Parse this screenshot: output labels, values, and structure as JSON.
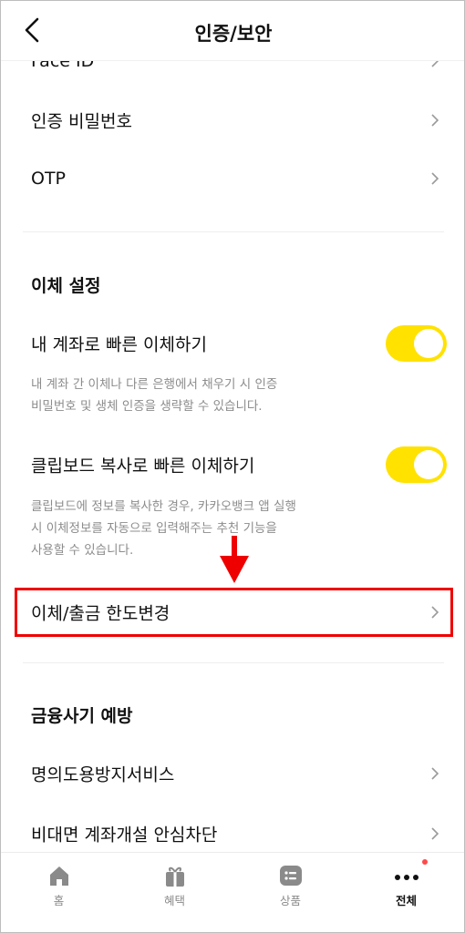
{
  "header": {
    "title": "인증/보안"
  },
  "security_items": [
    {
      "label": "Face ID"
    },
    {
      "label": "인증 비밀번호"
    },
    {
      "label": "OTP"
    }
  ],
  "transfer_settings": {
    "title": "이체 설정",
    "fast_own_account": {
      "label": "내 계좌로 빠른 이체하기",
      "enabled": true,
      "desc_lines": [
        "내 계좌 간 이체나 다른 은행에서 채우기 시 인증",
        "비밀번호 및 생체 인증을 생략할 수 있습니다."
      ]
    },
    "clipboard_transfer": {
      "label": "클립보드 복사로 빠른 이체하기",
      "enabled": true,
      "desc_lines": [
        "클립보드에 정보를 복사한 경우, 카카오뱅크 앱 실행",
        "시 이체정보를 자동으로 입력해주는 추천 기능을",
        "사용할 수 있습니다."
      ]
    },
    "limit_change": {
      "label": "이체/출금 한도변경"
    }
  },
  "fraud_prevention": {
    "title": "금융사기 예방",
    "items": [
      {
        "label": "명의도용방지서비스"
      },
      {
        "label": "비대면 계좌개설 안심차단"
      }
    ]
  },
  "tabbar": {
    "tabs": [
      {
        "label": "홈",
        "icon": "home-icon"
      },
      {
        "label": "혜택",
        "icon": "gift-icon"
      },
      {
        "label": "상품",
        "icon": "list-icon"
      },
      {
        "label": "전체",
        "icon": "more-dots-icon",
        "active": true
      }
    ]
  },
  "colors": {
    "toggle_on": "#ffe200",
    "highlight": "#ef0000",
    "notification_dot": "#ff4a4a"
  }
}
